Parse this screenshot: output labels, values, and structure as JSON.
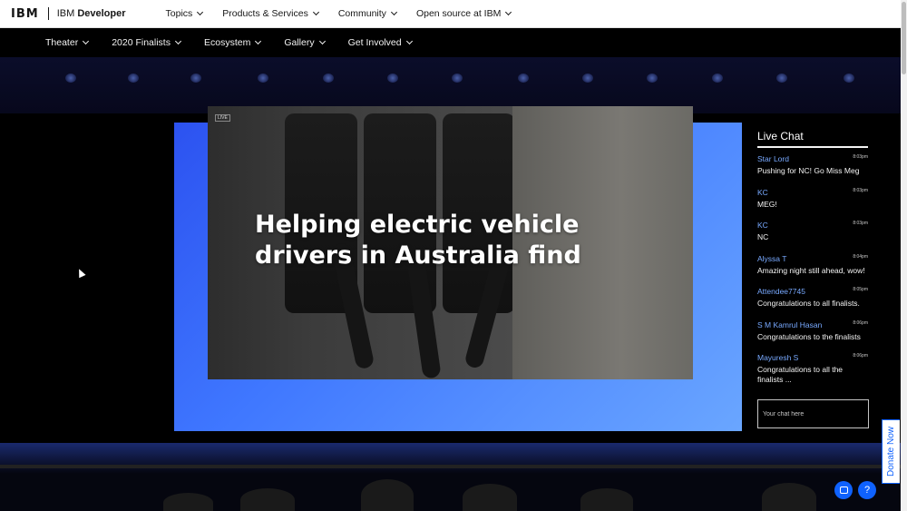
{
  "header": {
    "logo": "IBM",
    "brand_prefix": "IBM",
    "brand_name": "Developer",
    "menu": [
      "Topics",
      "Products & Services",
      "Community",
      "Open source at IBM"
    ]
  },
  "subnav": {
    "items": [
      "Theater",
      "2020 Finalists",
      "Ecosystem",
      "Gallery",
      "Get Involved"
    ]
  },
  "video": {
    "badge": "LIVE",
    "headline": "Helping electric vehicle drivers in Australia find"
  },
  "chat": {
    "title": "Live Chat",
    "messages": [
      {
        "user": "Star Lord",
        "time": "8:03pm",
        "text": "Pushing for NC! Go Miss Meg"
      },
      {
        "user": "KC",
        "time": "8:03pm",
        "text": "MEG!"
      },
      {
        "user": "KC",
        "time": "8:03pm",
        "text": "NC"
      },
      {
        "user": "Alyssa T",
        "time": "8:04pm",
        "text": "Amazing night still ahead, wow!"
      },
      {
        "user": "Attendee7745",
        "time": "8:05pm",
        "text": "Congratulations to all finalists."
      },
      {
        "user": "S M Kamrul Hasan",
        "time": "8:06pm",
        "text": "Congratulations to the finalists"
      },
      {
        "user": "Mayuresh S",
        "time": "8:06pm",
        "text": "Congratulations to all the finalists ..."
      }
    ],
    "input_placeholder": "Your chat here"
  },
  "donate": {
    "label": "Donate Now"
  },
  "help": {
    "label": "?"
  },
  "colors": {
    "accent": "#0f62fe",
    "link": "#78a9ff",
    "stage_blue": "#3f77ff"
  }
}
